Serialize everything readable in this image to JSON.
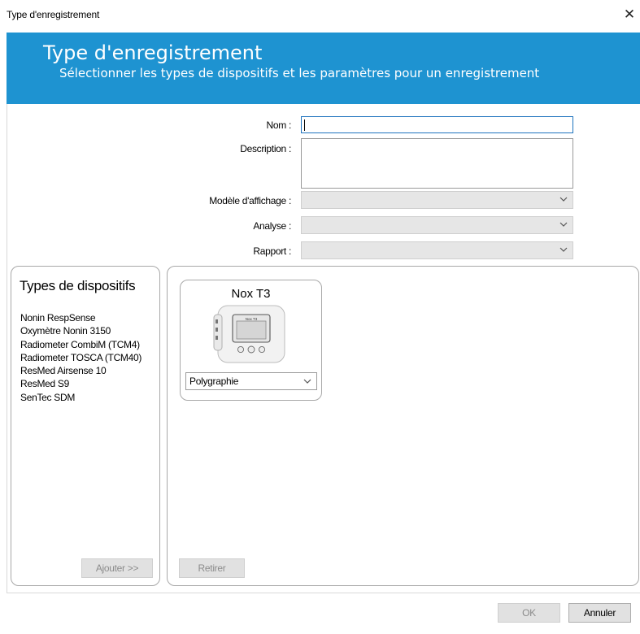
{
  "window": {
    "title": "Type d'enregistrement",
    "close_symbol": "✕"
  },
  "banner": {
    "heading": "Type d'enregistrement",
    "subtitle": "Sélectionner les types de dispositifs et les paramètres pour un enregistrement",
    "color": "#1e93d1"
  },
  "form": {
    "name_label": "Nom :",
    "name_value": "",
    "description_label": "Description :",
    "description_value": "",
    "display_model_label": "Modèle d'affichage :",
    "display_model_value": "",
    "analysis_label": "Analyse :",
    "analysis_value": "",
    "report_label": "Rapport :",
    "report_value": ""
  },
  "device_types": {
    "title": "Types de dispositifs",
    "items": [
      "Nonin RespSense",
      "Oxymètre Nonin 3150",
      "Radiometer CombiM (TCM4)",
      "Radiometer TOSCA (TCM40)",
      "ResMed Airsense 10",
      "ResMed S9",
      "SenTec SDM"
    ],
    "add_button": "Ajouter >>"
  },
  "selected_devices": {
    "cards": [
      {
        "name": "Nox T3",
        "device_screen_text": "Nox T3",
        "mode": "Polygraphie",
        "icon": "nox-t3-device-image"
      }
    ],
    "remove_button": "Retirer"
  },
  "footer": {
    "ok_button": "OK",
    "cancel_button": "Annuler"
  }
}
